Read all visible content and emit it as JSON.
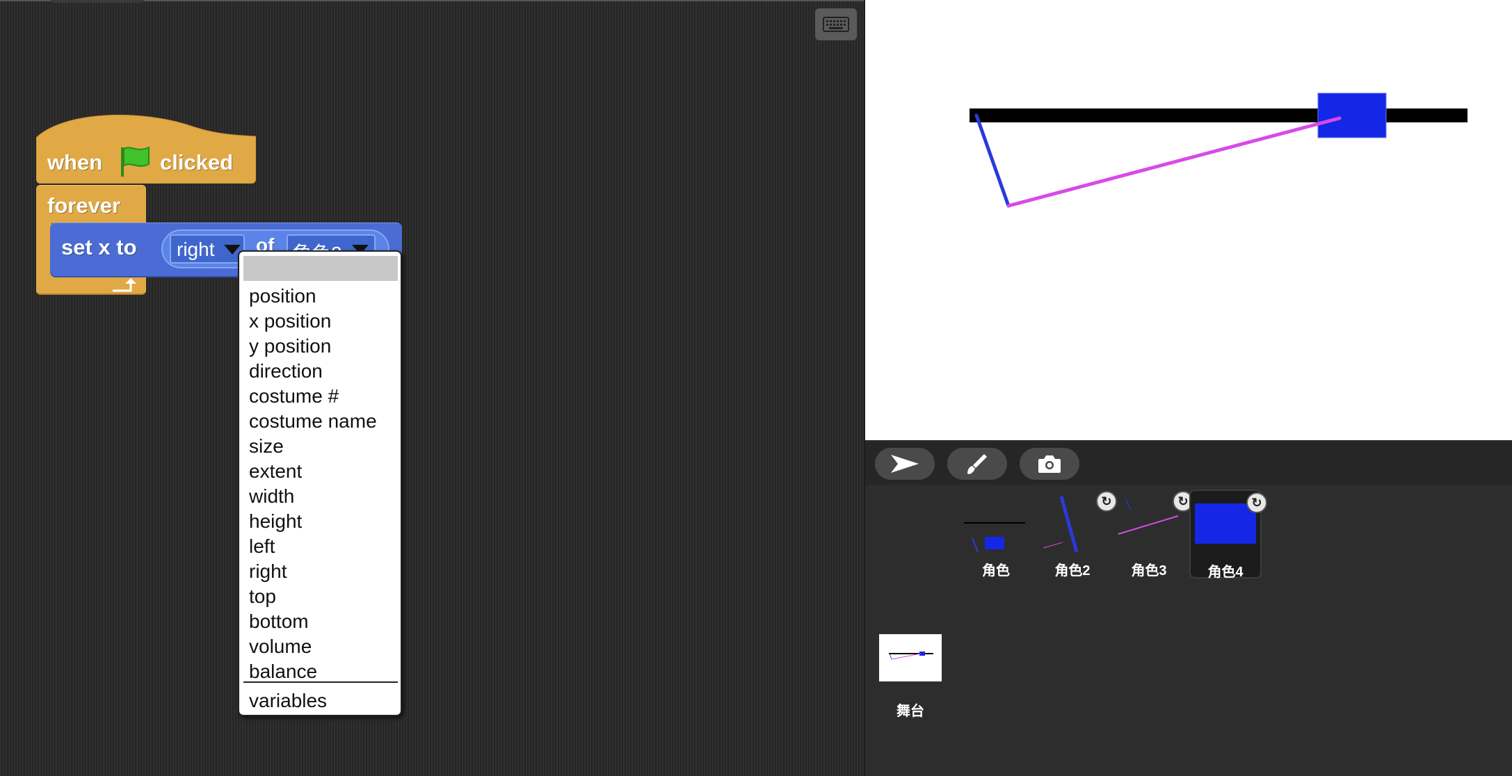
{
  "script": {
    "hat": {
      "when": "when",
      "clicked": "clicked"
    },
    "forever": "forever",
    "set_x": {
      "label": "set x to",
      "attribute": "right",
      "of": "of",
      "sprite": "角色2"
    }
  },
  "dropdown": {
    "items": [
      "position",
      "x position",
      "y position",
      "direction",
      "costume #",
      "costume name",
      "size",
      "extent",
      "width",
      "height",
      "left",
      "right",
      "top",
      "bottom",
      "volume",
      "balance"
    ],
    "footer": "variables"
  },
  "corral": {
    "sprites": [
      {
        "name": "角色",
        "selected": false,
        "rotation_badge": false
      },
      {
        "name": "角色2",
        "selected": false,
        "rotation_badge": true
      },
      {
        "name": "角色3",
        "selected": false,
        "rotation_badge": true
      },
      {
        "name": "角色4",
        "selected": true,
        "rotation_badge": true
      }
    ],
    "stage_label": "舞台",
    "rotation_glyph": "↻"
  },
  "tools": [
    "turtle-icon",
    "paintbrush-icon",
    "camera-icon"
  ],
  "colors": {
    "stage_bar": "#000000",
    "sprite_box": "#1427e6",
    "line_blue": "#2a3ad8",
    "line_magenta": "#d84ae8",
    "control_block": "#e1a945",
    "motion_block": "#4a6cd4"
  }
}
